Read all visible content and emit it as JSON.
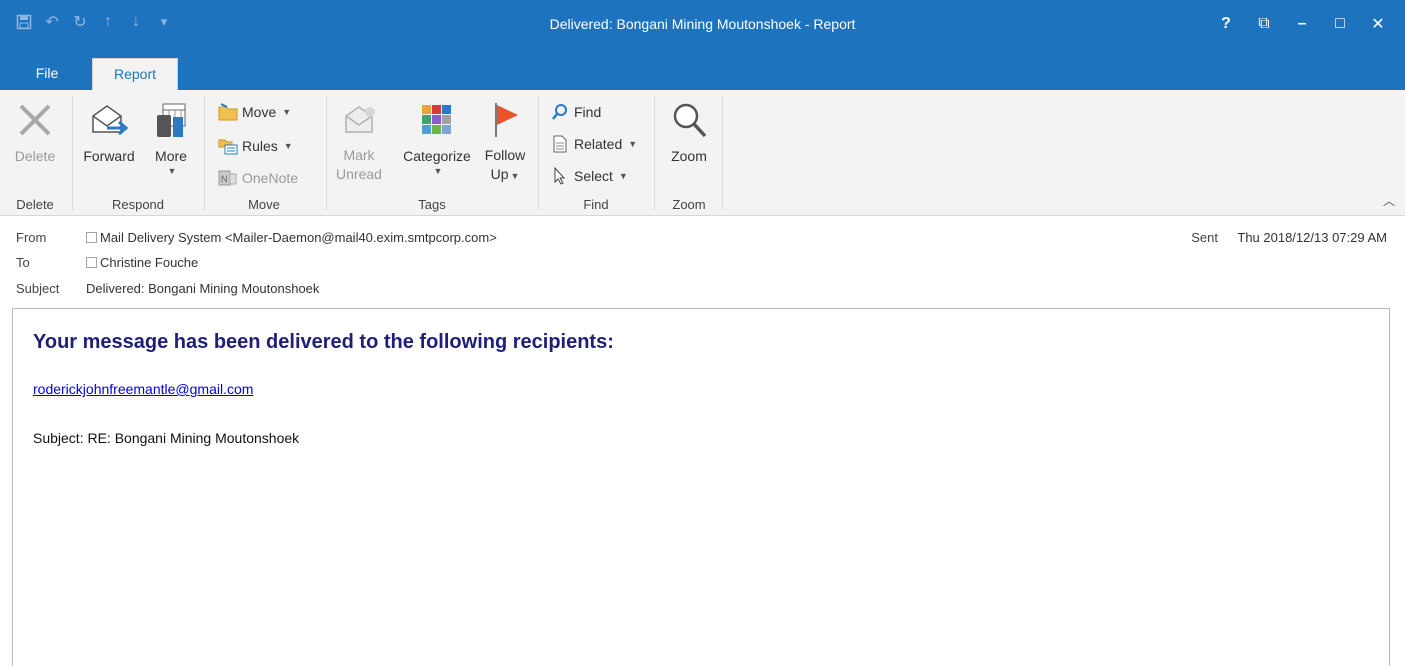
{
  "window": {
    "title": "Delivered: Bongani Mining Moutonshoek - Report",
    "controls": [
      "?",
      "⧉",
      "–",
      "□",
      "✕"
    ]
  },
  "tabs": [
    {
      "label": "File"
    },
    {
      "label": "Report",
      "active": true
    }
  ],
  "ribbon": {
    "delete": {
      "button": "Delete",
      "group": "Delete"
    },
    "respond": {
      "forward": "Forward",
      "more": "More",
      "group": "Respond"
    },
    "move": {
      "move": "Move",
      "rules": "Rules",
      "onenote": "OneNote",
      "group": "Move"
    },
    "tags": {
      "mark_line1": "Mark",
      "mark_line2": "Unread",
      "categorize": "Categorize",
      "follow_line1": "Follow",
      "follow_line2": "Up",
      "group": "Tags"
    },
    "find": {
      "find": "Find",
      "related": "Related",
      "select": "Select",
      "group": "Find"
    },
    "zoom": {
      "zoom": "Zoom",
      "group": "Zoom"
    }
  },
  "headers": {
    "from_label": "From",
    "from_value": "Mail Delivery System <Mailer-Daemon@mail40.exim.smtpcorp.com>",
    "to_label": "To",
    "to_value": "Christine Fouche",
    "subject_label": "Subject",
    "subject_value": "Delivered: Bongani Mining Moutonshoek",
    "sent_label": "Sent",
    "sent_value": "Thu 2018/12/13 07:29 AM"
  },
  "message": {
    "heading": "Your message has been delivered to the following recipients:",
    "recipient": "roderickjohnfreemantle@gmail.com",
    "subject_line": "Subject: RE: Bongani Mining Moutonshoek"
  },
  "colors": {
    "titlebar": "#1e73be",
    "heading": "#1f1f7a",
    "link": "#0000ee"
  }
}
